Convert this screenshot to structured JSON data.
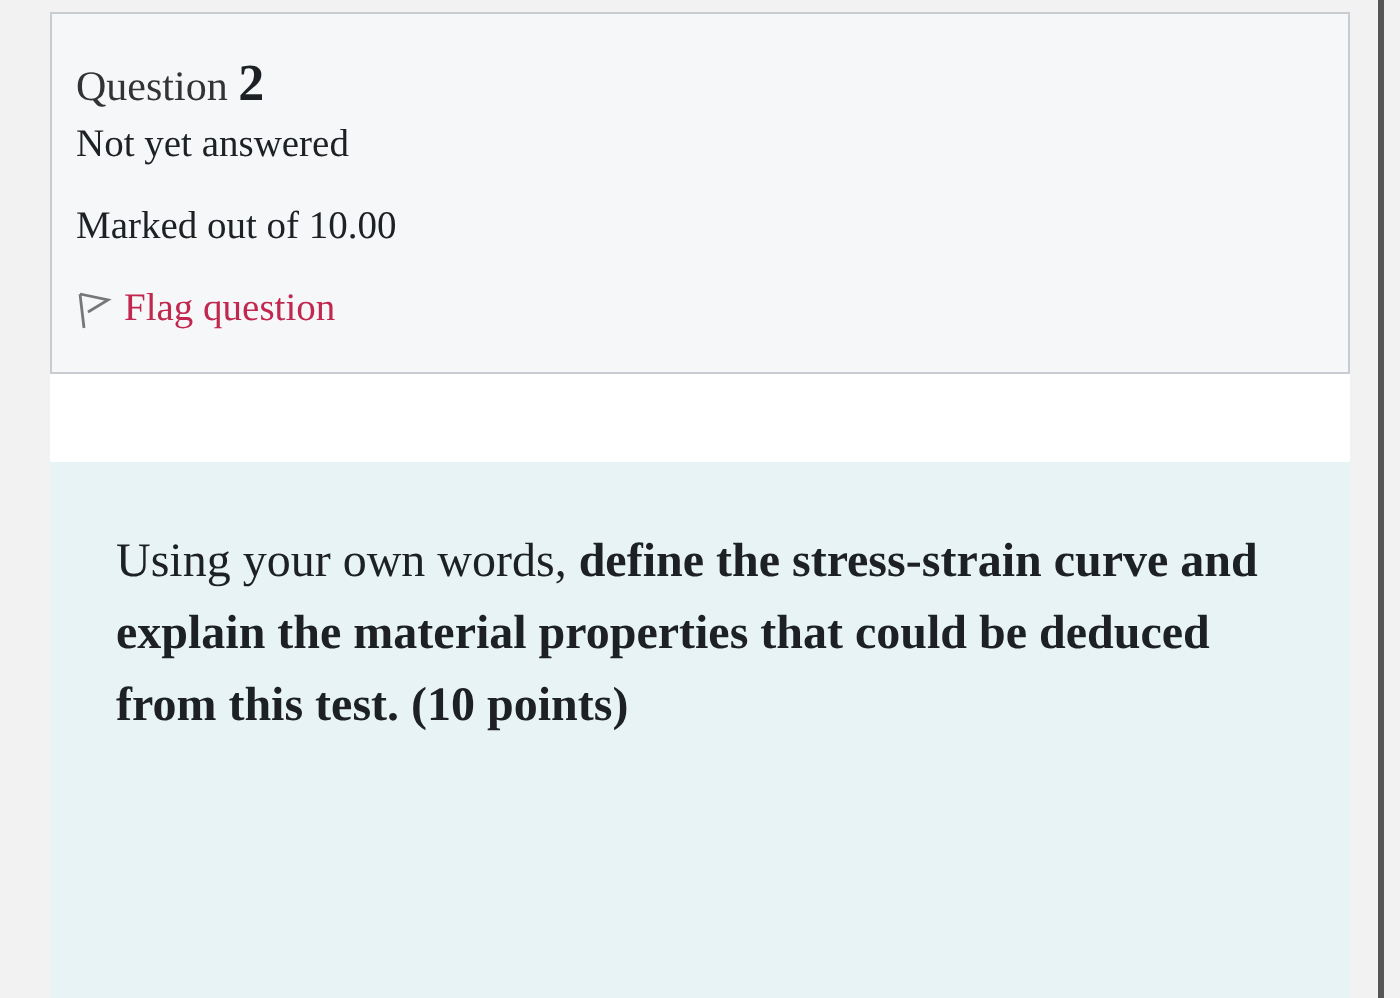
{
  "question_info": {
    "label": "Question",
    "number": "2",
    "state": "Not yet answered",
    "grade": "Marked out of 10.00",
    "flag": {
      "label": "Flag question",
      "flagged": false
    }
  },
  "question_text": "Using your own words,  **define the stress-strain curve and explain the material properties that could be deduced from this test. (10 points)**"
}
